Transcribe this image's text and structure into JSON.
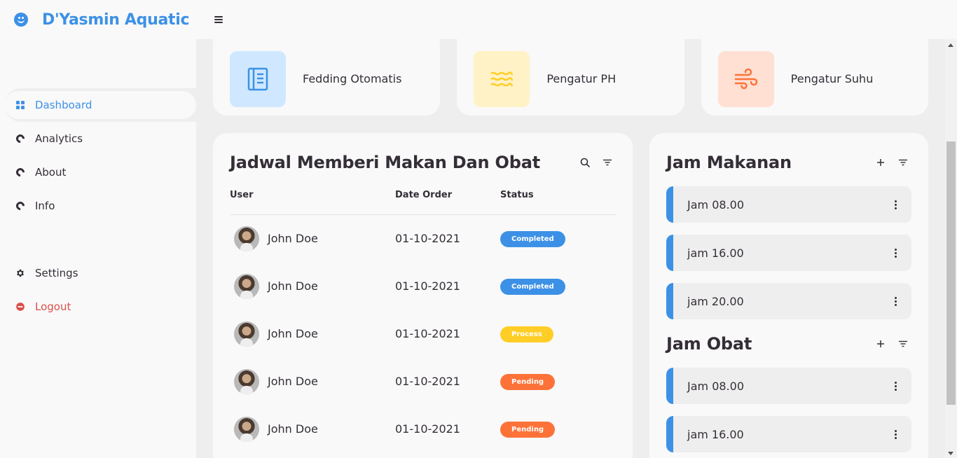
{
  "brand": {
    "name": "D'Yasmin Aquatic"
  },
  "sidebar": {
    "items": [
      {
        "label": "Dashboard",
        "icon": "dashboard-icon",
        "active": true
      },
      {
        "label": "Analytics",
        "icon": "analytics-icon"
      },
      {
        "label": "About",
        "icon": "about-icon"
      },
      {
        "label": "Info",
        "icon": "info-icon"
      }
    ],
    "bottom": [
      {
        "label": "Settings",
        "icon": "gear-icon"
      },
      {
        "label": "Logout",
        "icon": "logout-icon"
      }
    ]
  },
  "boxes": [
    {
      "label": "Fedding Otomatis",
      "icon": "book-icon",
      "tile_color": "#cfe8ff",
      "icon_color": "#3c91e6"
    },
    {
      "label": "Pengatur PH",
      "icon": "water-icon",
      "tile_color": "#fff2c6",
      "icon_color": "#ffce26"
    },
    {
      "label": "Pengatur Suhu",
      "icon": "wind-icon",
      "tile_color": "#ffe0d3",
      "icon_color": "#fd7238"
    }
  ],
  "order": {
    "title": "Jadwal Memberi Makan Dan Obat",
    "columns": [
      "User",
      "Date Order",
      "Status"
    ],
    "rows": [
      {
        "user": "John Doe",
        "date": "01-10-2021",
        "status": "Completed"
      },
      {
        "user": "John Doe",
        "date": "01-10-2021",
        "status": "Completed"
      },
      {
        "user": "John Doe",
        "date": "01-10-2021",
        "status": "Process"
      },
      {
        "user": "John Doe",
        "date": "01-10-2021",
        "status": "Pending"
      },
      {
        "user": "John Doe",
        "date": "01-10-2021",
        "status": "Pending"
      }
    ]
  },
  "makanan": {
    "title": "Jam Makanan",
    "items": [
      "Jam 08.00",
      "jam 16.00",
      "jam 20.00"
    ]
  },
  "obat": {
    "title": "Jam Obat",
    "items": [
      "Jam 08.00",
      "jam 16.00"
    ]
  },
  "colors": {
    "accent": "#3c91e6",
    "danger": "#db504a",
    "yellow": "#ffce26",
    "orange": "#fd7238"
  }
}
